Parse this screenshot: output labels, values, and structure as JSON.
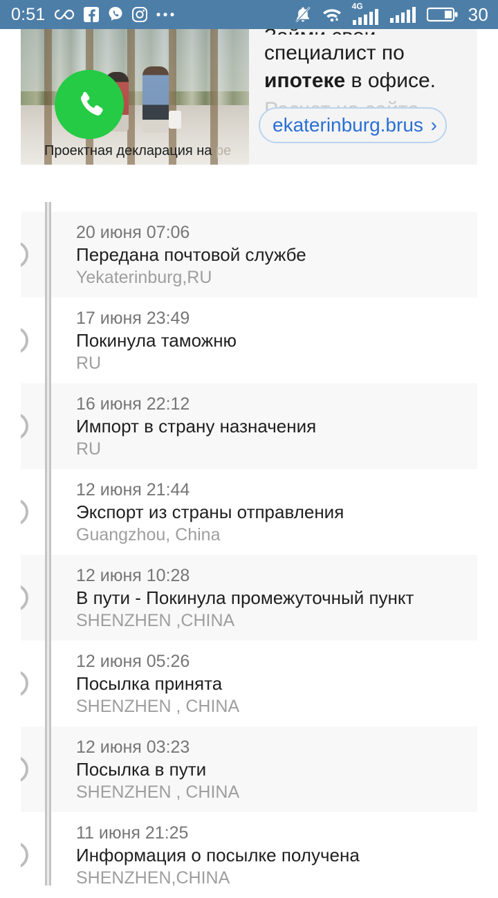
{
  "statusbar": {
    "clock": "0:51",
    "battery_percent": "30",
    "network_label": "4G",
    "icons": [
      "infinity-icon",
      "facebook-icon",
      "viber-icon",
      "instagram-icon",
      "more-icon",
      "mute-bell-icon",
      "wifi-icon",
      "signal-sim1-icon",
      "signal-sim2-icon",
      "battery-icon"
    ],
    "background_color": "#4d7ea8"
  },
  "ad": {
    "call_icon": "phone-icon",
    "call_button_color": "#25ca45",
    "disclaimer": "Проектная декларация на ",
    "disclaimer_faded": "ре",
    "headline_cut": "Займи свои",
    "headline_line1": "специалист по",
    "headline_bold": "ипотеке",
    "headline_rest": " в офисе.",
    "subline_faded": "Расчет на сайте",
    "link_text": "ekaterinburg.brus",
    "link_chevron": "›",
    "link_color": "#2a6fd4"
  },
  "timeline": {
    "events": [
      {
        "date": "20 июня 07:06",
        "status": "Передана почтовой службе",
        "location": "Yekaterinburg,RU"
      },
      {
        "date": "17 июня 23:49",
        "status": "Покинула таможню",
        "location": "RU"
      },
      {
        "date": "16 июня 22:12",
        "status": "Импорт в страну назначения",
        "location": "RU"
      },
      {
        "date": "12 июня 21:44",
        "status": "Экспорт из страны отправления",
        "location": "Guangzhou, China"
      },
      {
        "date": "12 июня 10:28",
        "status": "В пути - Покинула промежуточный пункт",
        "location": "SHENZHEN ,CHINA"
      },
      {
        "date": "12 июня 05:26",
        "status": "Посылка принята",
        "location": "SHENZHEN , CHINA"
      },
      {
        "date": "12 июня 03:23",
        "status": "Посылка в пути",
        "location": "SHENZHEN , CHINA"
      },
      {
        "date": "11 июня 21:25",
        "status": "Информация о посылке получена",
        "location": "SHENZHEN,CHINA"
      }
    ]
  }
}
